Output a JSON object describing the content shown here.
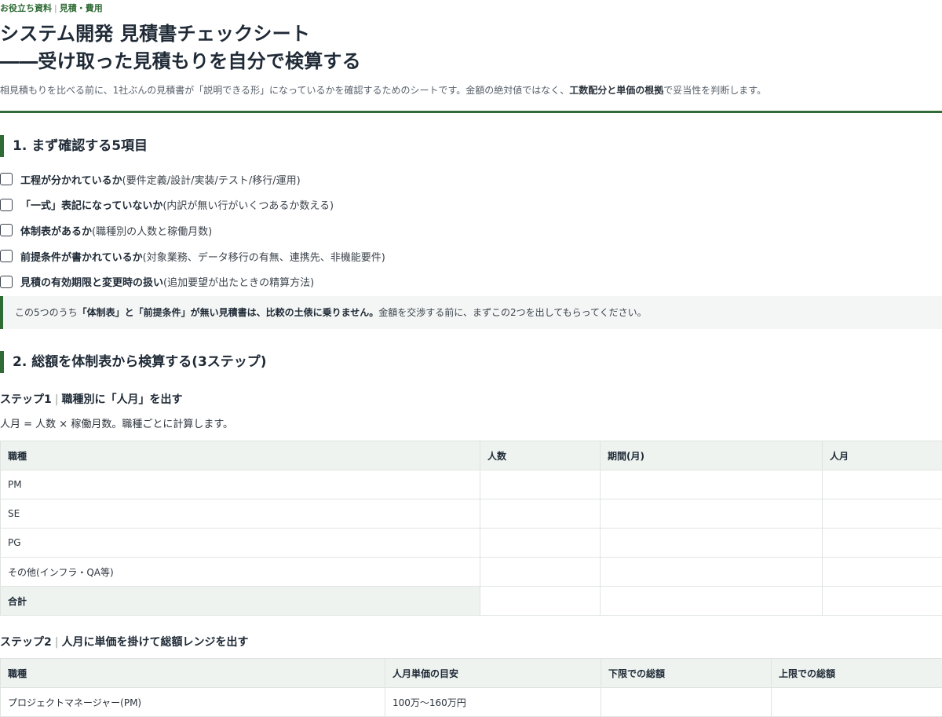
{
  "eyebrow": {
    "category": "お役立ち資料",
    "separator": "|",
    "topic": "見積・費用"
  },
  "title": {
    "line1": "システム開発 見積書チェックシート",
    "line2": "――受け取った見積もりを自分で検算する"
  },
  "lead": {
    "before": "相見積もりを比べる前に、1社ぶんの見積書が「説明できる形」になっているかを確認するためのシートです。金額の絶対値ではなく、",
    "emphasis": "工数配分と単価の根拠",
    "after": "で妥当性を判断します。"
  },
  "section1": {
    "heading": "1. まず確認する5項目",
    "items": [
      {
        "label": "工程が分かれているか",
        "note": "(要件定義/設計/実装/テスト/移行/運用)",
        "checked": false
      },
      {
        "label": "「一式」表記になっていないか",
        "note": "(内訳が無い行がいくつあるか数える)",
        "checked": false
      },
      {
        "label": "体制表があるか",
        "note": "(職種別の人数と稼働月数)",
        "checked": false
      },
      {
        "label": "前提条件が書かれているか",
        "note": "(対象業務、データ移行の有無、連携先、非機能要件)",
        "checked": false
      },
      {
        "label": "見積の有効期限と変更時の扱い",
        "note": "(追加要望が出たときの精算方法)",
        "checked": false
      }
    ],
    "callout": {
      "prefix": "この5つのうち",
      "emphasis": "「体制表」と「前提条件」が無い見積書は、比較の土俵に乗りません。",
      "suffix": "金額を交渉する前に、まずこの2つを出してもらってください。"
    }
  },
  "section2": {
    "heading": "2. 総額を体制表から検算する(3ステップ)",
    "step1": {
      "label": "ステップ1",
      "separator": "|",
      "title": "職種別に「人月」を出す",
      "formula": "人月 = 人数 × 稼働月数。職種ごとに計算します。",
      "table": {
        "headers": [
          "職種",
          "人数",
          "期間(月)",
          "人月"
        ],
        "rows": [
          [
            "PM",
            "",
            "",
            ""
          ],
          [
            "SE",
            "",
            "",
            ""
          ],
          [
            "PG",
            "",
            "",
            ""
          ],
          [
            "その他(インフラ・QA等)",
            "",
            "",
            ""
          ]
        ],
        "total": [
          "合計",
          "",
          "",
          ""
        ]
      }
    },
    "step2": {
      "label": "ステップ2",
      "separator": "|",
      "title": "人月に単価を掛けて総額レンジを出す",
      "table": {
        "headers": [
          "職種",
          "人月単価の目安",
          "下限での総額",
          "上限での総額"
        ],
        "rows": [
          [
            "プロジェクトマネージャー(PM)",
            "100万〜160万円",
            "",
            ""
          ]
        ]
      }
    }
  },
  "colors": {
    "accent": "#2f6b35",
    "header_bg": "#eef3f0",
    "callout_bg": "#f4f6f5",
    "text": "#1f2a36"
  }
}
